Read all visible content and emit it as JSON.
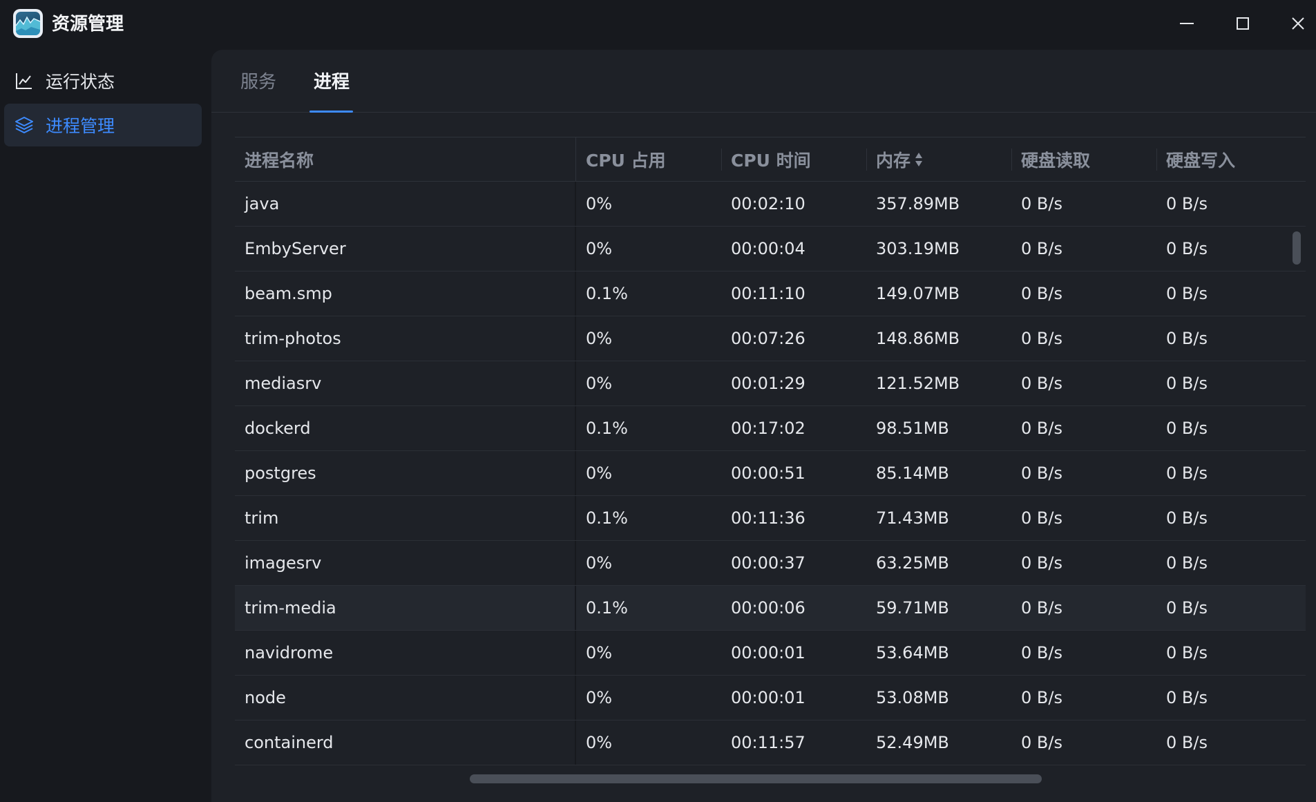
{
  "app": {
    "title": "资源管理",
    "logo_icon": "app-logo-chart-icon"
  },
  "window_controls": {
    "minimize_icon": "minimize-icon",
    "maximize_icon": "maximize-icon",
    "close_icon": "close-icon"
  },
  "sidebar": {
    "items": [
      {
        "label": "运行状态",
        "icon": "line-chart-icon",
        "active": false
      },
      {
        "label": "进程管理",
        "icon": "layers-icon",
        "active": true
      }
    ]
  },
  "tabs": [
    {
      "label": "服务",
      "active": false
    },
    {
      "label": "进程",
      "active": true
    }
  ],
  "table": {
    "headers": [
      "进程名称",
      "CPU 占用",
      "CPU 时间",
      "内存",
      "硬盘读取",
      "硬盘写入"
    ],
    "sorted_column": "内存",
    "rows": [
      [
        "java",
        "0%",
        "00:02:10",
        "357.89MB",
        "0 B/s",
        "0 B/s"
      ],
      [
        "EmbyServer",
        "0%",
        "00:00:04",
        "303.19MB",
        "0 B/s",
        "0 B/s"
      ],
      [
        "beam.smp",
        "0.1%",
        "00:11:10",
        "149.07MB",
        "0 B/s",
        "0 B/s"
      ],
      [
        "trim-photos",
        "0%",
        "00:07:26",
        "148.86MB",
        "0 B/s",
        "0 B/s"
      ],
      [
        "mediasrv",
        "0%",
        "00:01:29",
        "121.52MB",
        "0 B/s",
        "0 B/s"
      ],
      [
        "dockerd",
        "0.1%",
        "00:17:02",
        "98.51MB",
        "0 B/s",
        "0 B/s"
      ],
      [
        "postgres",
        "0%",
        "00:00:51",
        "85.14MB",
        "0 B/s",
        "0 B/s"
      ],
      [
        "trim",
        "0.1%",
        "00:11:36",
        "71.43MB",
        "0 B/s",
        "0 B/s"
      ],
      [
        "imagesrv",
        "0%",
        "00:00:37",
        "63.25MB",
        "0 B/s",
        "0 B/s"
      ],
      [
        "trim-media",
        "0.1%",
        "00:00:06",
        "59.71MB",
        "0 B/s",
        "0 B/s"
      ],
      [
        "navidrome",
        "0%",
        "00:00:01",
        "53.64MB",
        "0 B/s",
        "0 B/s"
      ],
      [
        "node",
        "0%",
        "00:00:01",
        "53.08MB",
        "0 B/s",
        "0 B/s"
      ],
      [
        "containerd",
        "0%",
        "00:11:57",
        "52.49MB",
        "0 B/s",
        "0 B/s"
      ]
    ],
    "hovered_row": 9
  },
  "colors": {
    "background": "#17191e",
    "panel": "#1e2127",
    "accent": "#3d8bff",
    "text": "#e6e8ec",
    "muted_text": "#8a909c"
  }
}
